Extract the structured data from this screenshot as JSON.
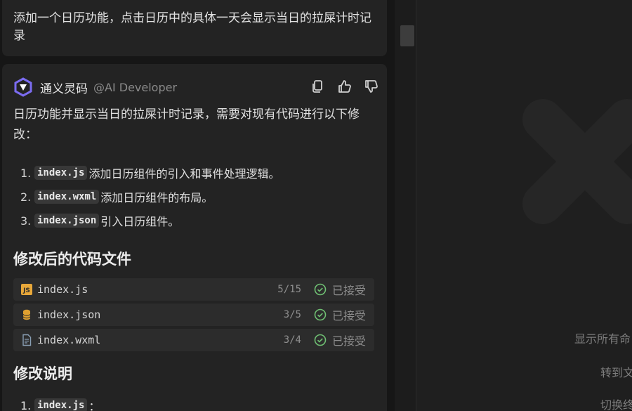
{
  "user_message": "添加一个日历功能，点击日历中的具体一天会显示当日的拉屎计时记录",
  "assistant": {
    "name": "通义灵码",
    "handle": "@AI Developer",
    "actions": [
      "copy-icon",
      "thumbs-up-icon",
      "thumbs-down-icon"
    ],
    "intro": "日历功能并显示当日的拉屎计时记录，需要对现有代码进行以下修改：",
    "steps": [
      {
        "num": "1.",
        "code": "index.js",
        "text": "添加日历组件的引入和事件处理逻辑。"
      },
      {
        "num": "2.",
        "code": "index.wxml",
        "text": "添加日历组件的布局。"
      },
      {
        "num": "3.",
        "code": "index.json",
        "text": "引入日历组件。"
      }
    ],
    "files_title": "修改后的代码文件",
    "files": [
      {
        "name": "index.js",
        "count": "5/15",
        "status": "已接受",
        "icon": "js-file-icon"
      },
      {
        "name": "index.json",
        "count": "3/5",
        "status": "已接受",
        "icon": "json-file-icon"
      },
      {
        "name": "index.wxml",
        "count": "3/4",
        "status": "已接受",
        "icon": "wxml-file-icon"
      }
    ],
    "notes_title": "修改说明",
    "notes_first": {
      "num": "1.",
      "code": "index.js",
      "text": "："
    }
  },
  "editor_hints": [
    "显示所有命",
    "转到文",
    "切换终"
  ],
  "colors": {
    "accent_check": "#6fbf73",
    "js_icon": "#e8a83a",
    "json_icon": "#e0a030",
    "logo_purple": "#7b6cf0"
  }
}
